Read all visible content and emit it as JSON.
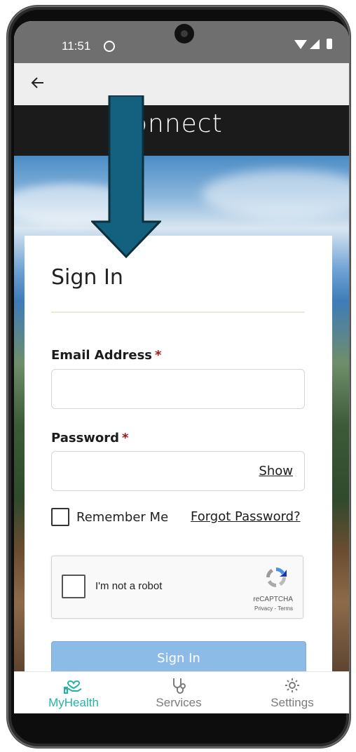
{
  "status_bar": {
    "time": "11:51"
  },
  "header": {
    "brand": "onnect"
  },
  "form": {
    "title": "Sign In",
    "email_label": "Email Address",
    "email_value": "",
    "password_label": "Password",
    "password_value": "",
    "required_mark": "*",
    "show_label": "Show",
    "remember_label": "Remember Me",
    "remember_checked": false,
    "forgot_label": "Forgot Password?",
    "signin_label": "Sign In"
  },
  "recaptcha": {
    "label": "I'm not a robot",
    "brand": "reCAPTCHA",
    "links": "Privacy - Terms"
  },
  "bottom_nav": {
    "items": [
      {
        "label": "MyHealth",
        "icon": "heart-hand-icon",
        "active": true
      },
      {
        "label": "Services",
        "icon": "stethoscope-icon",
        "active": false
      },
      {
        "label": "Settings",
        "icon": "gear-icon",
        "active": false
      }
    ]
  },
  "colors": {
    "accent": "#23b5a4",
    "button": "#8dbbe7",
    "required": "#a11717",
    "arrow": "#13607f"
  }
}
